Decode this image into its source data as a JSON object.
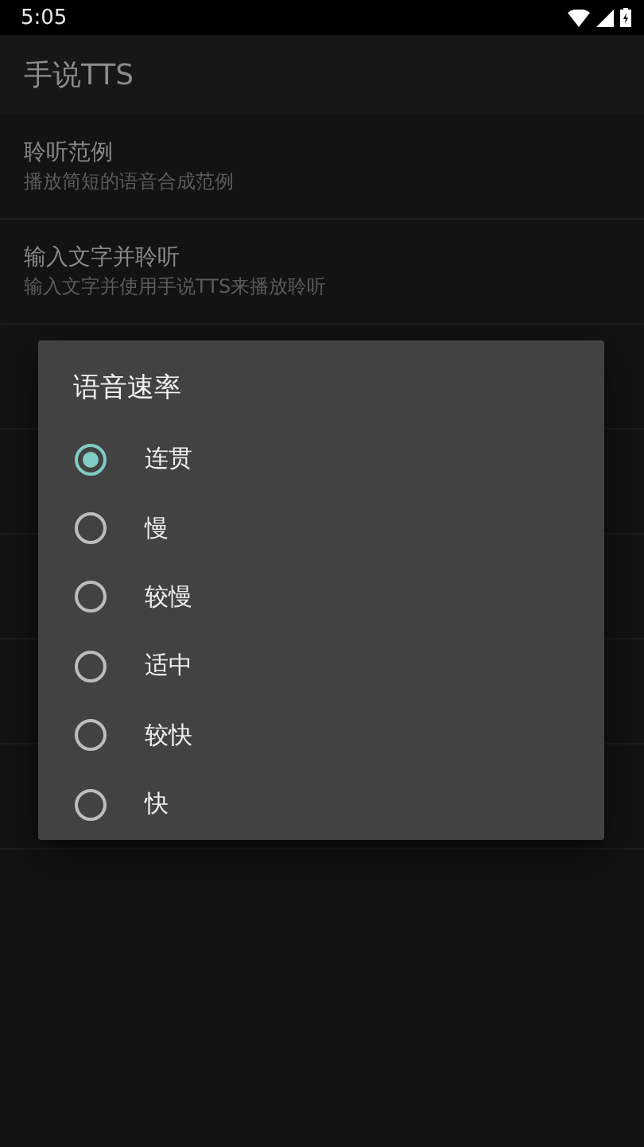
{
  "status_bar": {
    "time": "5:05"
  },
  "app_bar": {
    "title": "手说TTS"
  },
  "settings": [
    {
      "title": "聆听范例",
      "summary": "播放简短的语音合成范例"
    },
    {
      "title": "输入文字并聆听",
      "summary": "输入文字并使用手说TTS来播放聆听"
    }
  ],
  "dialog": {
    "title": "语音速率",
    "options": [
      {
        "label": "连贯",
        "selected": true
      },
      {
        "label": "慢",
        "selected": false
      },
      {
        "label": "较慢",
        "selected": false
      },
      {
        "label": "适中",
        "selected": false
      },
      {
        "label": "较快",
        "selected": false
      },
      {
        "label": "快",
        "selected": false
      }
    ]
  }
}
